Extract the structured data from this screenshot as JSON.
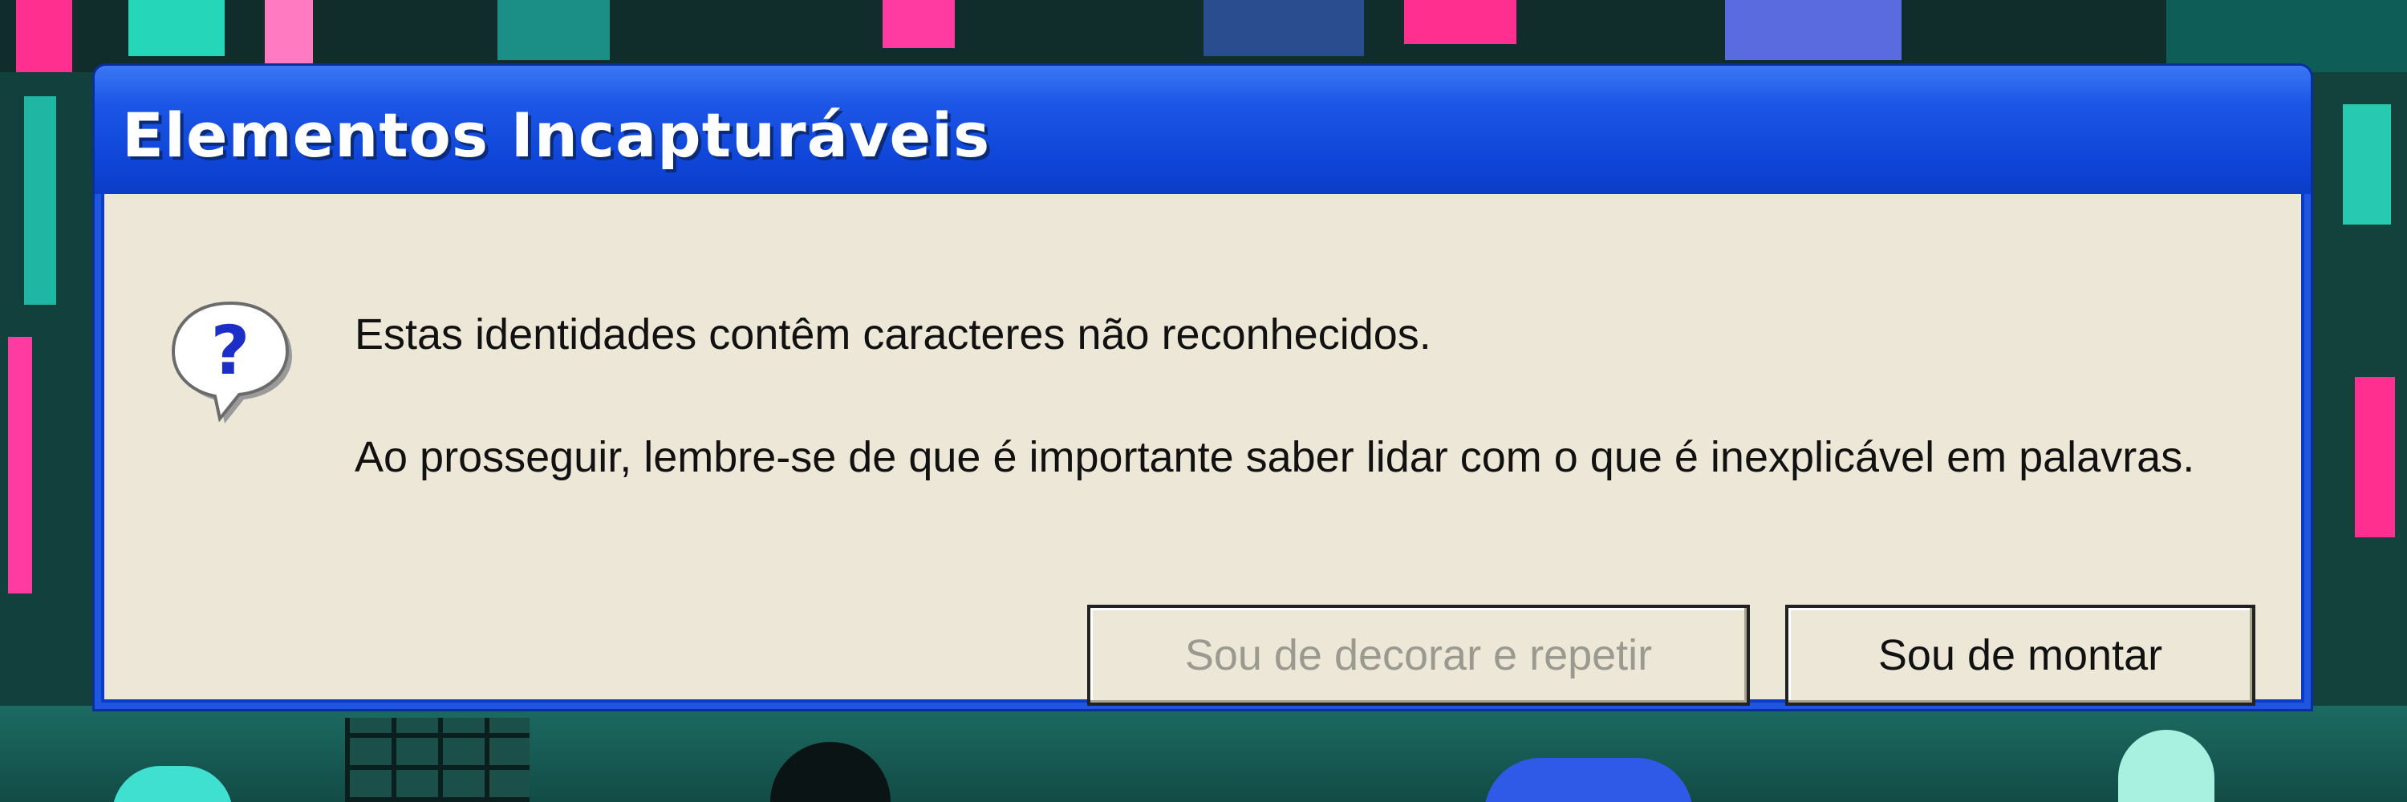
{
  "dialog": {
    "title": "Elementos Incapturáveis",
    "icon": "question-bubble-icon",
    "message_line1": "Estas identidades contêm caracteres não reconhecidos.",
    "message_line2": "Ao prosseguir, lembre-se de que é importante saber lidar com o que é inexplicável em palavras.",
    "buttons": {
      "secondary_label": "Sou de decorar e repetir",
      "primary_label": "Sou de montar"
    }
  },
  "colors": {
    "titlebar": "#1c56e6",
    "body": "#ece7d6",
    "background": "#0f3d3a",
    "accent_pink": "#ff3aa0"
  }
}
